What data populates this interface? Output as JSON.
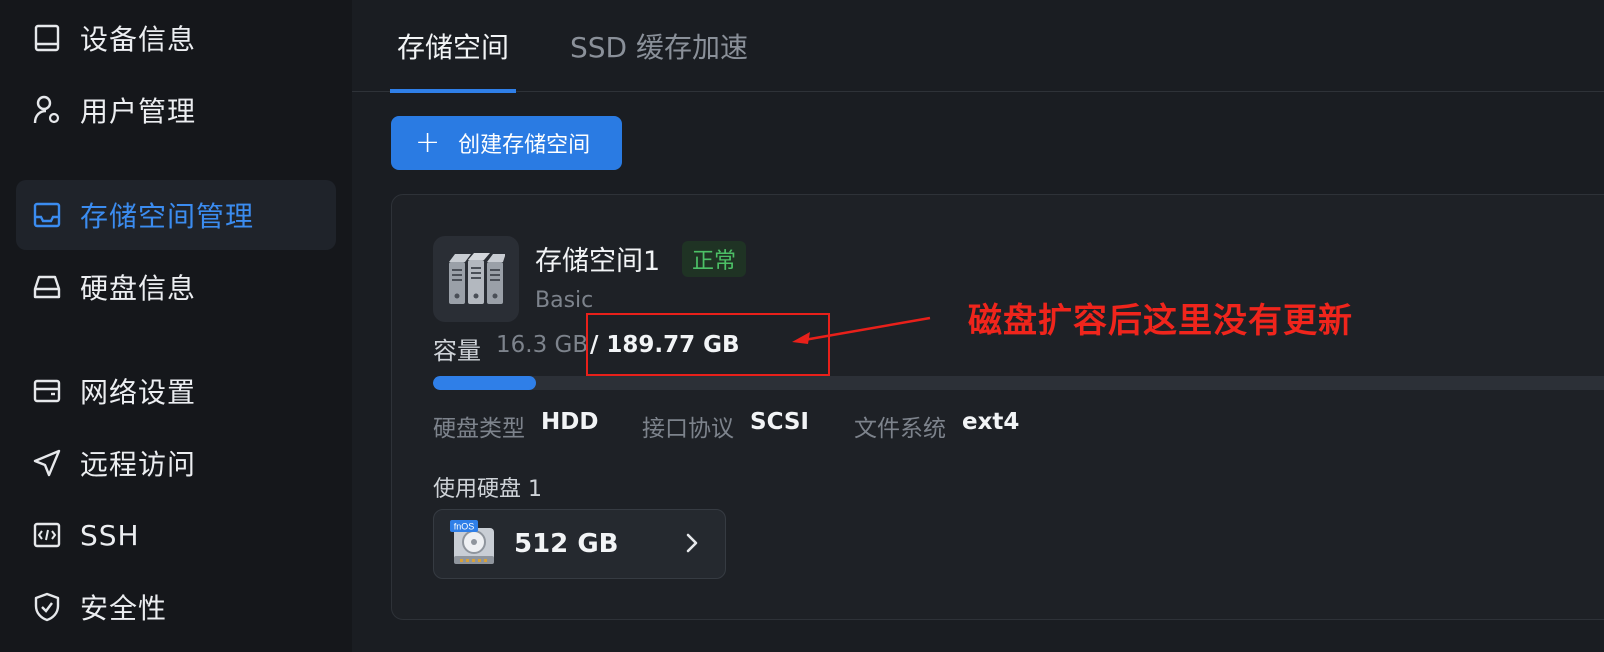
{
  "sidebar": {
    "items": [
      {
        "label": "设备信息",
        "icon": "device-icon",
        "active": false
      },
      {
        "label": "用户管理",
        "icon": "user-settings-icon",
        "active": false
      },
      {
        "label": "存储空间管理",
        "icon": "inbox-icon",
        "active": true
      },
      {
        "label": "硬盘信息",
        "icon": "hard-drive-icon",
        "active": false
      },
      {
        "label": "网络设置",
        "icon": "network-card-icon",
        "active": false
      },
      {
        "label": "远程访问",
        "icon": "send-icon",
        "active": false
      },
      {
        "label": "SSH",
        "icon": "code-icon",
        "active": false
      },
      {
        "label": "安全性",
        "icon": "shield-icon",
        "active": false
      }
    ]
  },
  "tabs": [
    {
      "label": "存储空间",
      "active": true
    },
    {
      "label": "SSD 缓存加速",
      "active": false
    }
  ],
  "toolbar": {
    "create_label": "创建存储空间",
    "create_icon": "plus-icon"
  },
  "pool": {
    "name": "存储空间1",
    "status": "正常",
    "type": "Basic",
    "capacity_label": "容量",
    "used": "16.3 GB",
    "total": "/ 189.77 GB",
    "usage_fraction": 0.086,
    "specs": [
      {
        "key": "硬盘类型",
        "value": "HDD"
      },
      {
        "key": "接口协议",
        "value": "SCSI"
      },
      {
        "key": "文件系统",
        "value": "ext4"
      }
    ],
    "disks_label": "使用硬盘 1",
    "disk": {
      "badge": "fnOS",
      "size": "512 GB"
    }
  },
  "annotation": {
    "text": "磁盘扩容后这里没有更新"
  },
  "colors": {
    "accent": "#2f7fe8",
    "status_ok": "#4cc066",
    "annotation": "#e8201a"
  }
}
